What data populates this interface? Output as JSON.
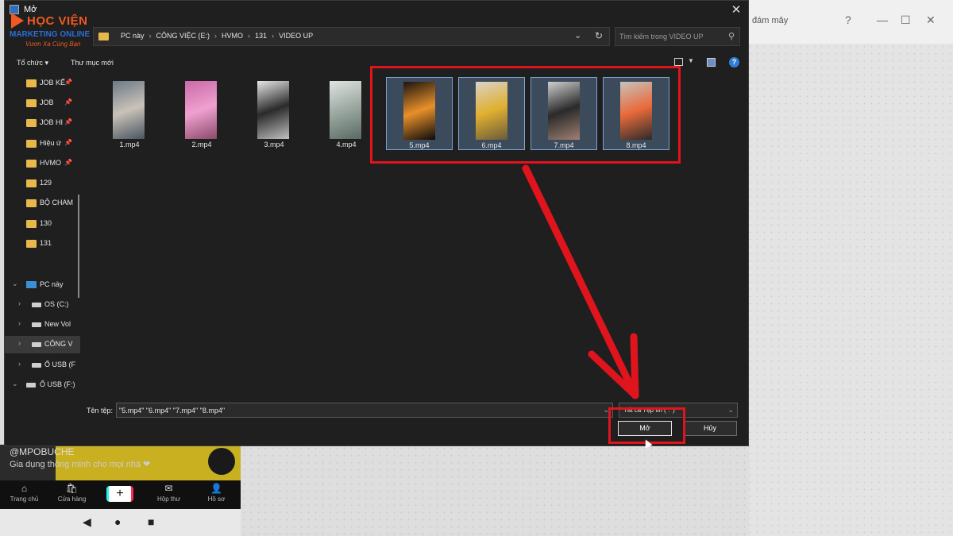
{
  "dialog": {
    "title": "Mở",
    "close_glyph": "✕",
    "address": {
      "crumbs": [
        "PC này",
        "CÔNG VIỆC (E:)",
        "HVMO",
        "131",
        "VIDEO UP"
      ],
      "separator": "›"
    },
    "search_placeholder": "Tìm kiếm trong VIDEO UP",
    "toolbar": {
      "organize": "Tổ chức ▾",
      "new_folder": "Thư mục mới"
    },
    "nav_items": [
      {
        "label": "JOB KẾ",
        "kind": "folder",
        "pinned": true
      },
      {
        "label": "JOB",
        "kind": "folder",
        "pinned": true
      },
      {
        "label": "JOB HI",
        "kind": "folder",
        "pinned": true
      },
      {
        "label": "Hiệu ứ",
        "kind": "folder",
        "pinned": true
      },
      {
        "label": "HVMO",
        "kind": "folder",
        "pinned": true
      },
      {
        "label": "129",
        "kind": "folder"
      },
      {
        "label": "BỘ CHAM",
        "kind": "folder"
      },
      {
        "label": "130",
        "kind": "folder"
      },
      {
        "label": "131",
        "kind": "folder"
      },
      {
        "label": "PC này",
        "kind": "pc"
      },
      {
        "label": "OS (C:)",
        "kind": "drive"
      },
      {
        "label": "New Vol",
        "kind": "drive"
      },
      {
        "label": "CÔNG V",
        "kind": "drive",
        "selected": true
      },
      {
        "label": "Ổ USB (F",
        "kind": "drive"
      },
      {
        "label": "Ổ USB (F:)",
        "kind": "drive"
      }
    ],
    "files": [
      {
        "name": "1.mp4",
        "selected": false,
        "colors": [
          "#6c7a86",
          "#c9c2b8",
          "#4a5560"
        ]
      },
      {
        "name": "2.mp4",
        "selected": false,
        "colors": [
          "#c96aa8",
          "#f0a0d0",
          "#8a4a6a"
        ]
      },
      {
        "name": "3.mp4",
        "selected": false,
        "colors": [
          "#e8e8e8",
          "#2a2a2a",
          "#c0c0c0"
        ]
      },
      {
        "name": "4.mp4",
        "selected": false,
        "colors": [
          "#e0e4e2",
          "#9aa8a0",
          "#5a6a62"
        ]
      },
      {
        "name": "5.mp4",
        "selected": true,
        "colors": [
          "#1a1410",
          "#e8902a",
          "#0a0a0a"
        ]
      },
      {
        "name": "6.mp4",
        "selected": true,
        "colors": [
          "#d9d2c8",
          "#e0b030",
          "#6a5a3a"
        ]
      },
      {
        "name": "7.mp4",
        "selected": true,
        "colors": [
          "#cfcfcf",
          "#2a2a2a",
          "#a08070"
        ]
      },
      {
        "name": "8.mp4",
        "selected": true,
        "colors": [
          "#c8c2bc",
          "#e86a3a",
          "#2a2a2a"
        ]
      }
    ],
    "filename_label": "Tên tệp:",
    "filename_value": "\"5.mp4\" \"6.mp4\" \"7.mp4\" \"8.mp4\"",
    "filetype_value": "Tất cả Tệp tin (*.*)",
    "open_button": "Mở",
    "cancel_button": "Hủy"
  },
  "logo": {
    "line1": "HỌC VIỆN",
    "line2": "MARKETING ONLINE",
    "line3": "Vươn Xa Cùng Bạn"
  },
  "background": {
    "cloud_text": "đám mây",
    "phone_caption_1": "@MPOBUCHE",
    "phone_caption_2": "Gia dụng thông minh cho mọi nhà ❤",
    "tabs": [
      {
        "label": "Trang chủ",
        "icon": "⌂"
      },
      {
        "label": "Cửa hàng",
        "icon": "🛍"
      },
      {
        "label": "Hộp thư",
        "icon": "✉"
      },
      {
        "label": "Hồ sơ",
        "icon": "👤"
      }
    ],
    "plus_glyph": "+"
  },
  "accent_red": "#e0141c"
}
